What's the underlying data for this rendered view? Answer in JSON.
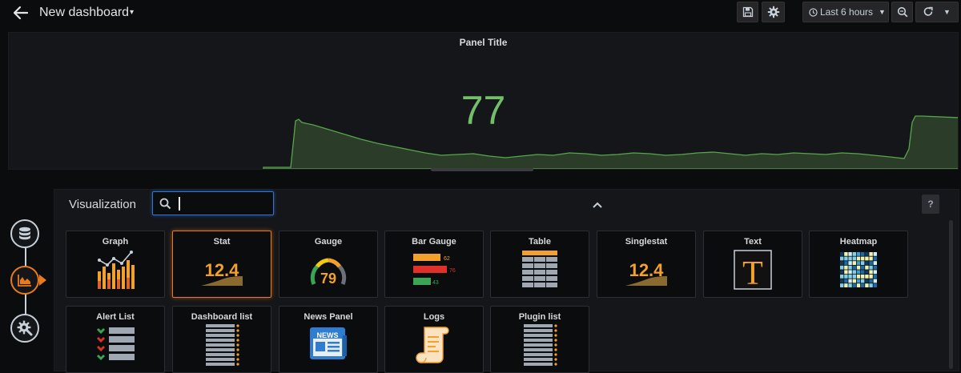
{
  "header": {
    "title": "New dashboard",
    "time_range": "Last 6 hours"
  },
  "panel": {
    "title": "Panel Title",
    "value": "77",
    "value_color": "#73bf69"
  },
  "visualization": {
    "label": "Visualization",
    "search_value": "",
    "help_label": "?",
    "selected": "Stat",
    "accent": "#eb7b18",
    "cards": [
      {
        "label": "Graph",
        "icon": "graph-icon"
      },
      {
        "label": "Stat",
        "icon": "stat-icon",
        "icon_text": "12.4"
      },
      {
        "label": "Gauge",
        "icon": "gauge-icon",
        "icon_text": "79"
      },
      {
        "label": "Bar Gauge",
        "icon": "bar-gauge-icon",
        "icon_values": [
          "62",
          "76",
          "43"
        ]
      },
      {
        "label": "Table",
        "icon": "table-icon"
      },
      {
        "label": "Singlestat",
        "icon": "singlestat-icon",
        "icon_text": "12.4"
      },
      {
        "label": "Text",
        "icon": "text-icon",
        "icon_text": "T"
      },
      {
        "label": "Heatmap",
        "icon": "heatmap-icon"
      },
      {
        "label": "Alert List",
        "icon": "alert-list-icon"
      },
      {
        "label": "Dashboard list",
        "icon": "dashboard-list-icon"
      },
      {
        "label": "News Panel",
        "icon": "news-icon",
        "icon_text": "NEWS"
      },
      {
        "label": "Logs",
        "icon": "logs-icon"
      },
      {
        "label": "Plugin list",
        "icon": "plugin-list-icon"
      }
    ]
  }
}
